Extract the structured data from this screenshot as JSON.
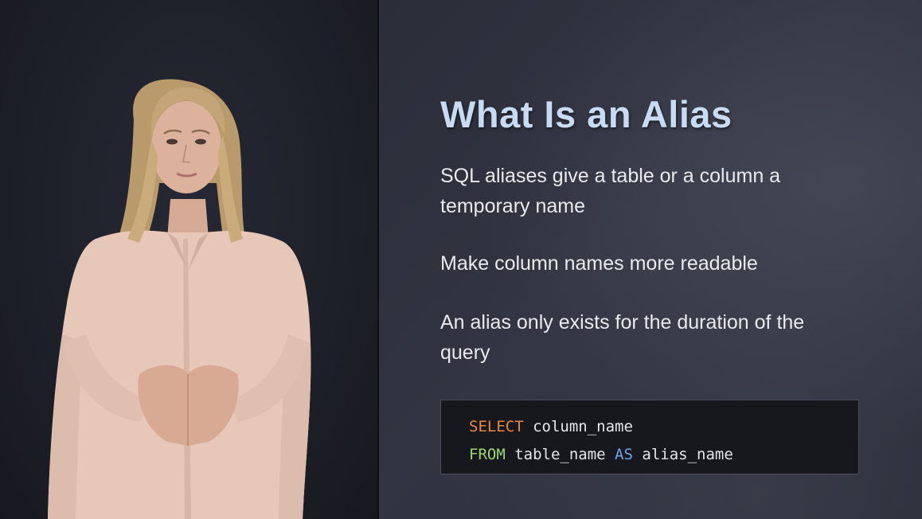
{
  "slide": {
    "title": "What Is an Alias",
    "bullets": [
      "SQL aliases give a table or a column a temporary name",
      "Make column names more readable",
      "An alias only exists for the duration of the query"
    ],
    "code": {
      "line1": {
        "keyword": "SELECT",
        "rest": " column_name"
      },
      "line2": {
        "keyword": "FROM",
        "middle": " table_name ",
        "keyword2": "AS",
        "rest": " alias_name"
      }
    }
  },
  "colors": {
    "title": "#c7dcf2",
    "keyword_select": "#e8893a",
    "keyword_from": "#9fd66b",
    "keyword_as": "#6aa6e8",
    "code_background": "#16181e"
  },
  "icons": {
    "presenter": "presenter-person"
  }
}
